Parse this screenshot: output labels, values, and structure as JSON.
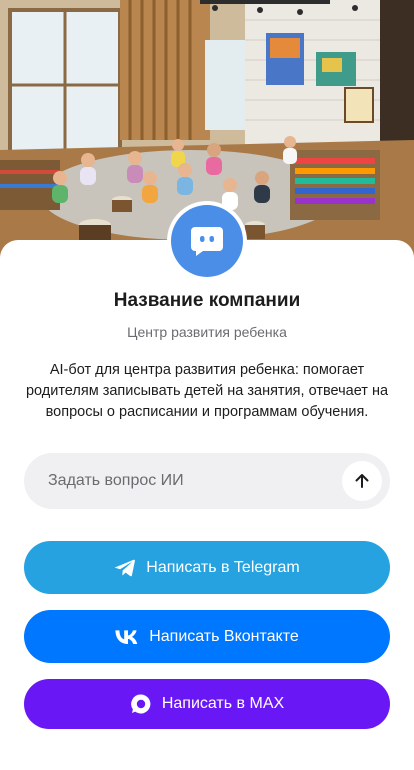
{
  "header_image": {
    "alt": "",
    "colors": {
      "sky": "#e8f0f4",
      "wall": "#d8cfc0",
      "floor": "#a97a48",
      "rug": "#c9c4bb",
      "art_blue": "#4a76c8",
      "art_orange": "#e58a3a"
    }
  },
  "company": {
    "avatar_icon": "chat-bubble-icon",
    "name": "Название компании",
    "tagline": "Центр развития ребенка",
    "description": "AI-бот для центра развития ребенка: помогает родителям записывать детей на занятия, отвечает на вопросы о расписании и программам обучения."
  },
  "ask": {
    "placeholder": "Задать вопрос ИИ",
    "send_icon": "arrow-up-icon"
  },
  "buttons": [
    {
      "label": "Написать в Telegram",
      "icon": "telegram-icon",
      "color": "#26a2e0"
    },
    {
      "label": "Написать Вконтакте",
      "icon": "vk-icon",
      "color": "#0077ff"
    },
    {
      "label": "Написать в MAX",
      "icon": "max-icon",
      "color": "#6a17f5"
    }
  ],
  "colors": {
    "avatar": "#4a8ee8",
    "text": "#1c1c1e",
    "muted": "#6b6b70",
    "input_bg": "#f0f0f2"
  }
}
